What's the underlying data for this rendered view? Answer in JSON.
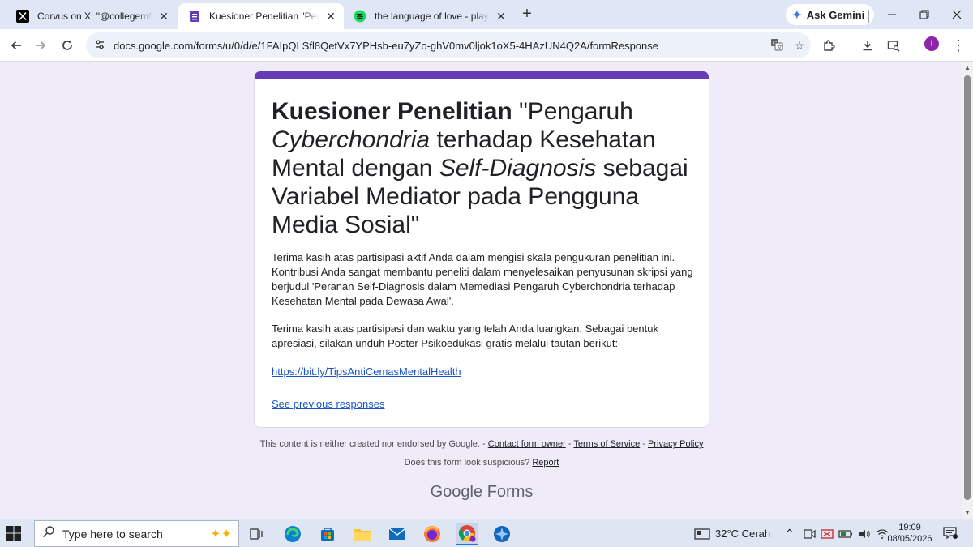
{
  "browser": {
    "tabs": [
      {
        "title": "Corvus on X: \"@collegemfs Ini a",
        "icon": "x-logo-icon"
      },
      {
        "title": "Kuesioner Penelitian \"Pengaruh",
        "icon": "google-forms-icon",
        "active": true
      },
      {
        "title": "the language of love - playlist b",
        "icon": "spotify-icon"
      }
    ],
    "gemini_label": "Ask Gemini",
    "url": "docs.google.com/forms/u/0/d/e/1FAIpQLSfl8QetVx7YPHsb-eu7yZo-ghV0mv0ljok1oX5-4HAzUN4Q2A/formResponse",
    "profile_initial": "I"
  },
  "form": {
    "accent_color": "#673ab7",
    "title_bold": "Kuesioner Penelitian",
    "title_t1": " \"Pengaruh ",
    "title_i1": "Cyberchondria",
    "title_t2": " terhadap Kesehatan Mental dengan ",
    "title_i2": "Self-Diagnosis",
    "title_t3": " sebagai Variabel Mediator pada Pengguna Media Sosial\"",
    "paragraph1": "Terima kasih atas partisipasi aktif Anda dalam mengisi skala pengukuran penelitian ini. Kontribusi Anda sangat membantu peneliti dalam menyelesaikan penyusunan skripsi yang berjudul 'Peranan Self-Diagnosis dalam Memediasi Pengaruh Cyberchondria terhadap Kesehatan Mental pada Dewasa Awal'.",
    "paragraph2": " Terima kasih atas partisipasi dan waktu yang telah Anda luangkan. Sebagai bentuk apresiasi, silakan unduh Poster Psikoedukasi gratis melalui tautan berikut:",
    "link": "https://bit.ly/TipsAntiCemasMentalHealth",
    "previous_responses": "See previous responses"
  },
  "footer": {
    "disclaimer": "This content is neither created nor endorsed by Google. - ",
    "contact": "Contact form owner",
    "sep": " - ",
    "terms": "Terms of Service",
    "privacy": "Privacy Policy",
    "suspicious": "Does this form look suspicious? ",
    "report": "Report",
    "logo_google": "Google",
    "logo_forms": "Forms"
  },
  "taskbar": {
    "search_placeholder": "Type here to search",
    "weather": "32°C  Cerah",
    "time": "19:09",
    "date": "08/05/2026"
  }
}
